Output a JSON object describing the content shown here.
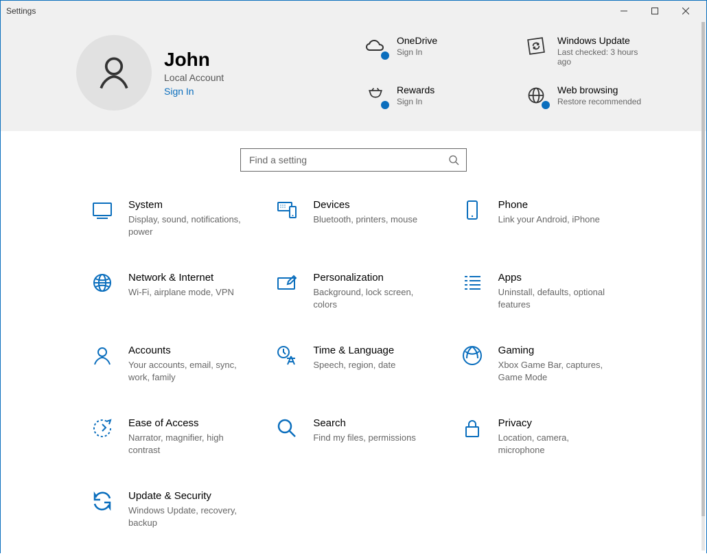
{
  "window": {
    "title": "Settings"
  },
  "user": {
    "name": "John",
    "sub": "Local Account",
    "signin": "Sign In"
  },
  "header_tiles": {
    "onedrive": {
      "title": "OneDrive",
      "sub": "Sign In"
    },
    "update": {
      "title": "Windows Update",
      "sub": "Last checked: 3 hours ago"
    },
    "rewards": {
      "title": "Rewards",
      "sub": "Sign In"
    },
    "web": {
      "title": "Web browsing",
      "sub": "Restore recommended"
    }
  },
  "search": {
    "placeholder": "Find a setting"
  },
  "categories": {
    "system": {
      "title": "System",
      "sub": "Display, sound, notifications, power"
    },
    "devices": {
      "title": "Devices",
      "sub": "Bluetooth, printers, mouse"
    },
    "phone": {
      "title": "Phone",
      "sub": "Link your Android, iPhone"
    },
    "network": {
      "title": "Network & Internet",
      "sub": "Wi-Fi, airplane mode, VPN"
    },
    "personal": {
      "title": "Personalization",
      "sub": "Background, lock screen, colors"
    },
    "apps": {
      "title": "Apps",
      "sub": "Uninstall, defaults, optional features"
    },
    "accounts": {
      "title": "Accounts",
      "sub": "Your accounts, email, sync, work, family"
    },
    "time": {
      "title": "Time & Language",
      "sub": "Speech, region, date"
    },
    "gaming": {
      "title": "Gaming",
      "sub": "Xbox Game Bar, captures, Game Mode"
    },
    "ease": {
      "title": "Ease of Access",
      "sub": "Narrator, magnifier, high contrast"
    },
    "searchcat": {
      "title": "Search",
      "sub": "Find my files, permissions"
    },
    "privacy": {
      "title": "Privacy",
      "sub": "Location, camera, microphone"
    },
    "updatesec": {
      "title": "Update & Security",
      "sub": "Windows Update, recovery, backup"
    }
  }
}
